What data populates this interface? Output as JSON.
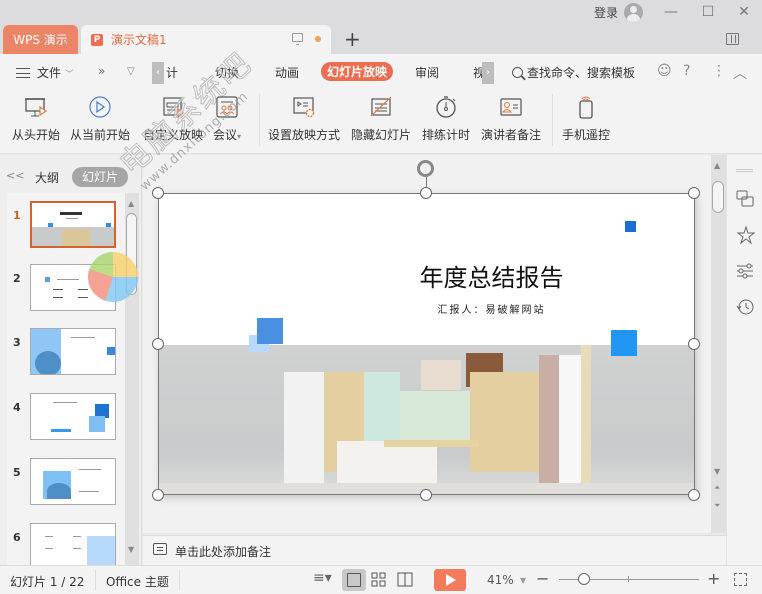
{
  "titlebar": {
    "app_tab": "WPS 演示",
    "doc_tab": "演示文稿1",
    "doc_icon": "P",
    "login": "登录",
    "new_tab": "+",
    "minimize": "—",
    "maximize": "☐",
    "close": "✕"
  },
  "menubar": {
    "file": "文件",
    "more": "»",
    "items": [
      "计",
      "切换",
      "动画",
      "幻灯片放映",
      "审阅",
      "视"
    ],
    "active": "幻灯片放映",
    "search": "查找命令、搜索模板"
  },
  "ribbon": {
    "buttons": [
      {
        "label": "从头开始",
        "icon": "play-from-start-icon"
      },
      {
        "label": "从当前开始",
        "icon": "play-from-current-icon"
      },
      {
        "label": "自定义放映",
        "icon": "custom-show-icon"
      },
      {
        "label": "会议",
        "icon": "meeting-icon"
      },
      {
        "label": "设置放映方式",
        "icon": "show-settings-icon"
      },
      {
        "label": "隐藏幻灯片",
        "icon": "hide-slide-icon"
      },
      {
        "label": "排练计时",
        "icon": "rehearse-timing-icon"
      },
      {
        "label": "演讲者备注",
        "icon": "speaker-notes-icon"
      },
      {
        "label": "手机遥控",
        "icon": "phone-remote-icon"
      }
    ]
  },
  "leftpanel": {
    "collapse": "<<",
    "outline_tab": "大纲",
    "slides_tab": "幻灯片",
    "thumbnails": [
      {
        "number": "1",
        "active": true
      },
      {
        "number": "2",
        "active": false
      },
      {
        "number": "3",
        "active": false
      },
      {
        "number": "4",
        "active": false
      },
      {
        "number": "5",
        "active": false
      },
      {
        "number": "6",
        "active": false
      }
    ]
  },
  "slide": {
    "title": "年度总结报告",
    "subtitle": "汇报人：易破解网站"
  },
  "watermark": {
    "line1": "电脑系统吧",
    "line2": "www.dnxitong.com"
  },
  "notes": {
    "placeholder": "单击此处添加备注"
  },
  "statusbar": {
    "slide_counter": "幻灯片 1 / 22",
    "theme": "Office 主题",
    "zoom": "41%",
    "zoom_fraction": 0.18
  }
}
